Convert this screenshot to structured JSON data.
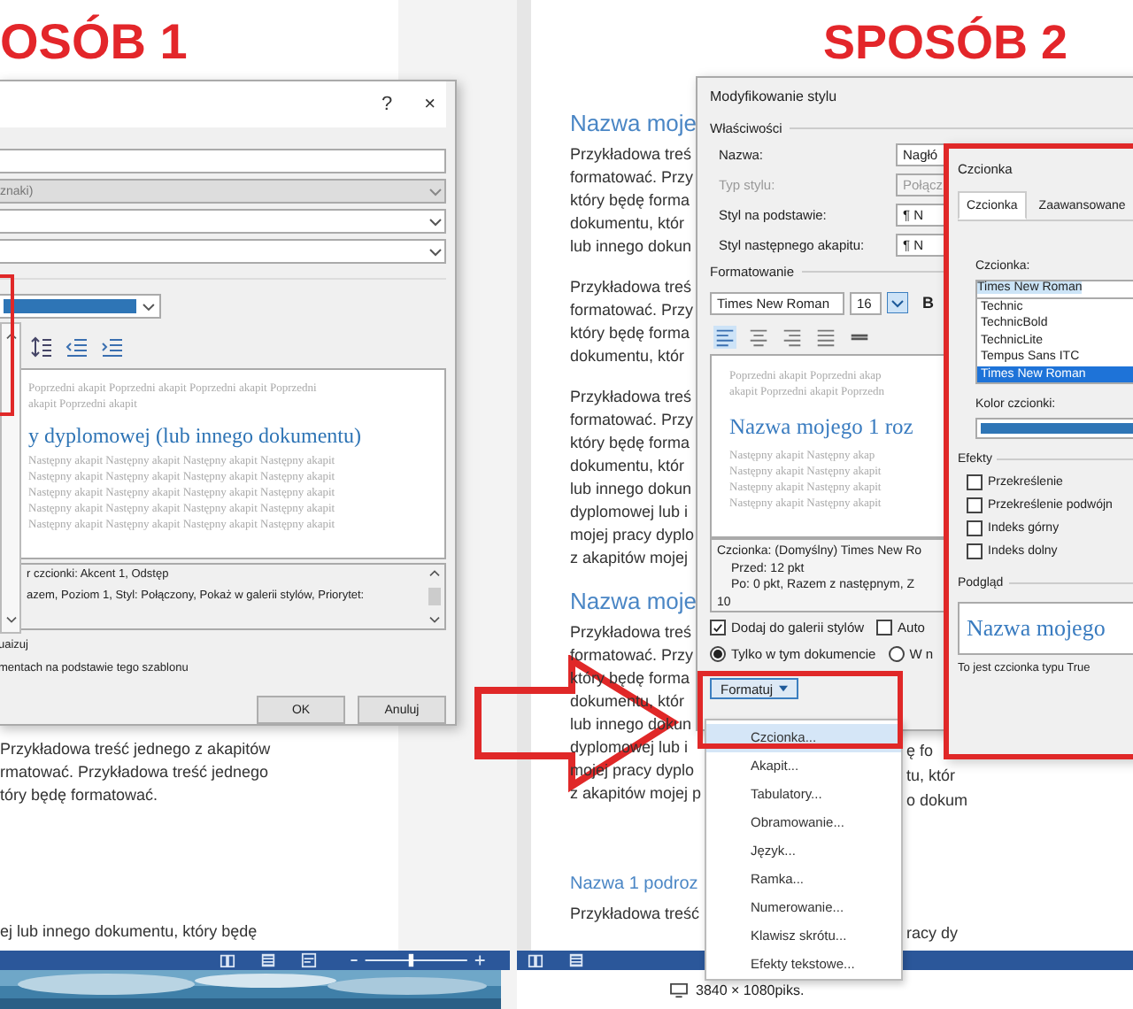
{
  "left_screen": {
    "heading": "OSÓB 1",
    "dialog": {
      "help": "?",
      "close": "×",
      "type_value": "znaki)",
      "preview_before": [
        "Poprzedni akapit Poprzedni akapit Poprzedni akapit Poprzedni",
        "akapit Poprzedni akapit"
      ],
      "preview_heading": "y dyplomowej (lub innego dokumentu)",
      "preview_after": [
        "Następny akapit Następny akapit Następny akapit Następny akapit",
        "Następny akapit Następny akapit Następny akapit Następny akapit",
        "Następny akapit Następny akapit Następny akapit Następny akapit",
        "Następny akapit Następny akapit Następny akapit Następny akapit",
        "Następny akapit Następny akapit Następny akapit Następny akapit"
      ],
      "description": [
        "r czcionki: Akcent 1, Odstęp",
        "azem, Poziom 1, Styl: Połączony, Pokaż w galerii stylów, Priorytet:"
      ],
      "options": [
        "uaizuj",
        "mentach na podstawie tego szablonu"
      ],
      "buttons": [
        "OK",
        "Anuluj"
      ]
    },
    "document_lines": [
      "Przykładowa treść jednego z akapitów",
      "rmatować. Przykładowa treść jednego",
      "tóry będę formatować."
    ],
    "document_bottom_line": "ej lub innego dokumentu, który będę",
    "zoom_slider": {
      "level": 0.45
    }
  },
  "right_screen": {
    "heading": "SPOSÓB 2",
    "document": [
      {
        "kind": "heading",
        "text": "Nazwa moje"
      },
      {
        "kind": "paragraph",
        "lines": [
          "Przykładowa treś",
          "formatować. Przy",
          "który będę forma",
          "dokumentu, któr",
          "lub innego dokun"
        ]
      },
      {
        "kind": "paragraph",
        "lines": [
          "Przykładowa treś",
          "formatować. Przy",
          "który będę forma",
          "dokumentu, któr"
        ]
      },
      {
        "kind": "paragraph",
        "lines": [
          "Przykładowa treś",
          "formatować. Przy",
          "który będę forma",
          "dokumentu, któr",
          "lub innego dokun",
          "dyplomowej lub i",
          "mojej pracy dyplo",
          "z akapitów mojej"
        ]
      },
      {
        "kind": "heading",
        "text": "Nazwa moje"
      },
      {
        "kind": "paragraph",
        "lines": [
          "Przykładowa treś",
          "formatować. Przy",
          "który będę forma",
          "dokumentu, któr",
          "lub innego dokun",
          "dyplomowej lub i",
          "mojej pracy dyplo",
          "z akapitów mojej p"
        ]
      },
      {
        "kind": "subheading",
        "text": "Nazwa 1 podroz"
      },
      {
        "kind": "paragraph",
        "lines": [
          "Przykładowa treść"
        ]
      }
    ],
    "document_fragments": [
      "ę fo",
      "tu, któr",
      "o dokum",
      "racy dy"
    ],
    "style_dialog": {
      "title": "Modyfikowanie stylu",
      "properties_label": "Właściwości",
      "fields": [
        {
          "label": "Nazwa:",
          "value": "Nagłó",
          "disabled": false
        },
        {
          "label": "Typ stylu:",
          "value": "Połącz",
          "disabled": true
        },
        {
          "label": "Styl na podstawie:",
          "value": "¶ N",
          "disabled": false
        },
        {
          "label": "Styl następnego akapitu:",
          "value": "¶ N",
          "disabled": false
        }
      ],
      "formatting_label": "Formatowanie",
      "font": "Times New Roman",
      "size": "16",
      "bold": "B",
      "preview_before": [
        "Poprzedni akapit Poprzedni akap",
        "akapit Poprzedni akapit Poprzedn"
      ],
      "preview_heading": "Nazwa mojego 1 roz",
      "preview_after": [
        "Następny akapit Następny akap",
        "Następny akapit Następny akapit",
        "Następny akapit Następny akapit",
        "Następny akapit Następny akapit"
      ],
      "description": [
        "Czcionka: (Domyślny) Times New Ro",
        "Przed:  12 pkt",
        "Po:  0 pkt, Razem z następnym, Z",
        "10"
      ],
      "checkboxes": [
        {
          "label": "Dodaj do galerii stylów",
          "checked": true
        },
        {
          "label": "Auto",
          "checked": false
        }
      ],
      "radios": [
        {
          "label": "Tylko w tym dokumencie",
          "selected": true
        },
        {
          "label": "W n",
          "selected": false
        }
      ],
      "format_button": "Formatuj"
    },
    "format_menu": [
      {
        "label": "Czcionka...",
        "selected": true
      },
      {
        "label": "Akapit...",
        "selected": false
      },
      {
        "label": "Tabulatory...",
        "selected": false
      },
      {
        "label": "Obramowanie...",
        "selected": false
      },
      {
        "label": "Język...",
        "selected": false
      },
      {
        "label": "Ramka...",
        "selected": false
      },
      {
        "label": "Numerowanie...",
        "selected": false
      },
      {
        "label": "Klawisz skrótu...",
        "selected": false
      },
      {
        "label": "Efekty tekstowe...",
        "selected": false
      }
    ],
    "font_dialog": {
      "title": "Czcionka",
      "tabs": [
        {
          "label": "Czcionka",
          "selected": true
        },
        {
          "label": "Zaawansowane",
          "selected": false
        }
      ],
      "font_label": "Czcionka:",
      "font_value": "Times New Roman",
      "fonts": [
        {
          "label": "Technic",
          "selected": false
        },
        {
          "label": "TechnicBold",
          "selected": false
        },
        {
          "label": "TechnicLite",
          "selected": false
        },
        {
          "label": "Tempus Sans ITC",
          "selected": false
        },
        {
          "label": "Times New Roman",
          "selected": true
        }
      ],
      "color_label": "Kolor czcionki:",
      "effects_label": "Efekty",
      "effects": [
        {
          "label": "Przekreślenie",
          "checked": false
        },
        {
          "label": "Przekreślenie podwójn",
          "checked": false
        },
        {
          "label": "Indeks górny",
          "checked": false
        },
        {
          "label": "Indeks dolny",
          "checked": false
        }
      ],
      "preview_label": "Podgląd",
      "preview_text": "Nazwa mojego",
      "note": "To jest czcionka typu True"
    },
    "status_text": "3840 × 1080piks."
  }
}
